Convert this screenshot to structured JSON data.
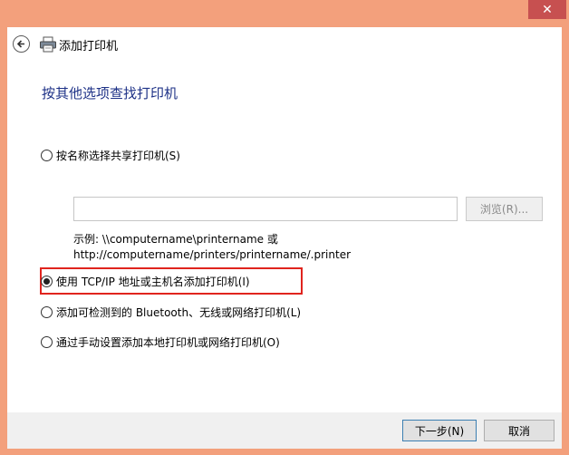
{
  "window": {
    "title": "添加打印机",
    "close_glyph": "✕"
  },
  "page": {
    "heading": "按其他选项查找打印机"
  },
  "options": [
    {
      "label": "按名称选择共享打印机(S)",
      "selected": false
    },
    {
      "label": "使用 TCP/IP 地址或主机名添加打印机(I)",
      "selected": true
    },
    {
      "label": "添加可检测到的 Bluetooth、无线或网络打印机(L)",
      "selected": false
    },
    {
      "label": "通过手动设置添加本地打印机或网络打印机(O)",
      "selected": false
    }
  ],
  "shared_printer": {
    "input_value": "",
    "browse_label": "浏览(R)...",
    "example_line1": "示例: \\\\computername\\printername 或",
    "example_line2": "http://computername/printers/printername/.printer"
  },
  "footer": {
    "next_label": "下一步(N)",
    "cancel_label": "取消"
  },
  "colors": {
    "frame": "#f3a07c",
    "heading": "#1e3287",
    "highlight": "#e0241e",
    "close": "#c75050"
  },
  "icons": [
    "back-arrow-icon",
    "printer-icon",
    "close-icon"
  ]
}
